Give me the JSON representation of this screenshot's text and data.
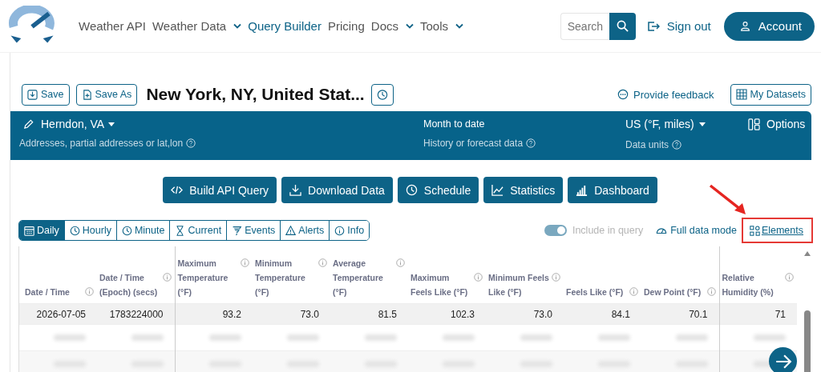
{
  "nav": {
    "items": [
      {
        "label": "Weather API",
        "dropdown": false,
        "selected": false
      },
      {
        "label": "Weather Data",
        "dropdown": true,
        "selected": false
      },
      {
        "label": "Query Builder",
        "dropdown": false,
        "selected": true
      },
      {
        "label": "Pricing",
        "dropdown": false,
        "selected": false
      },
      {
        "label": "Docs",
        "dropdown": true,
        "selected": false
      },
      {
        "label": "Tools",
        "dropdown": true,
        "selected": false
      }
    ],
    "search": {
      "placeholder": "Search"
    },
    "sign_out": "Sign out",
    "account": "Account"
  },
  "toolbar": {
    "save": "Save",
    "save_as": "Save As",
    "title": "New York, NY, United Stat...",
    "feedback": "Provide feedback",
    "datasets": "My Datasets"
  },
  "panel": {
    "location": "Herndon, VA",
    "location_hint": "Addresses, partial addresses or lat,lon",
    "period": "Month to date",
    "period_hint": "History or forecast data",
    "units": "US (°F, miles)",
    "units_hint": "Data units",
    "options": "Options"
  },
  "actions": [
    {
      "label": "Build API Query",
      "kind": "code"
    },
    {
      "label": "Download Data",
      "kind": "download"
    },
    {
      "label": "Schedule",
      "kind": "clock"
    },
    {
      "label": "Statistics",
      "kind": "line"
    },
    {
      "label": "Dashboard",
      "kind": "bars"
    }
  ],
  "tabs": [
    {
      "label": "Daily",
      "kind": "calendar",
      "selected": true
    },
    {
      "label": "Hourly",
      "kind": "clock",
      "selected": false
    },
    {
      "label": "Minute",
      "kind": "clock",
      "selected": false
    },
    {
      "label": "Current",
      "kind": "hourglass",
      "selected": false
    },
    {
      "label": "Events",
      "kind": "storm",
      "selected": false
    },
    {
      "label": "Alerts",
      "kind": "alert",
      "selected": false
    },
    {
      "label": "Info",
      "kind": "info",
      "selected": false
    }
  ],
  "include_in_query": {
    "label": "Include in query",
    "on": true,
    "disabled": true
  },
  "full_data_mode": "Full data mode",
  "elements": {
    "label": "Elements",
    "highlighted": true
  },
  "table": {
    "columns": [
      "Date / Time",
      "Date / Time (Epoch) (secs)",
      "Maximum Temperature (°F)",
      "Minimum Temperature (°F)",
      "Average Temperature (°F)",
      "Maximum Feels Like (°F)",
      "Minimum Feels Like (°F)",
      "Feels Like (°F)",
      "Dew Point (°F)",
      "Relative Humidity (%)"
    ],
    "rows": [
      [
        "2026-07-05",
        "1783224000",
        "93.2",
        "73.0",
        "81.5",
        "102.3",
        "73.0",
        "84.1",
        "70.1",
        "71"
      ]
    ],
    "blurred_rows": [
      {
        "kind": "blurred"
      },
      {
        "kind": "blurred"
      }
    ]
  }
}
